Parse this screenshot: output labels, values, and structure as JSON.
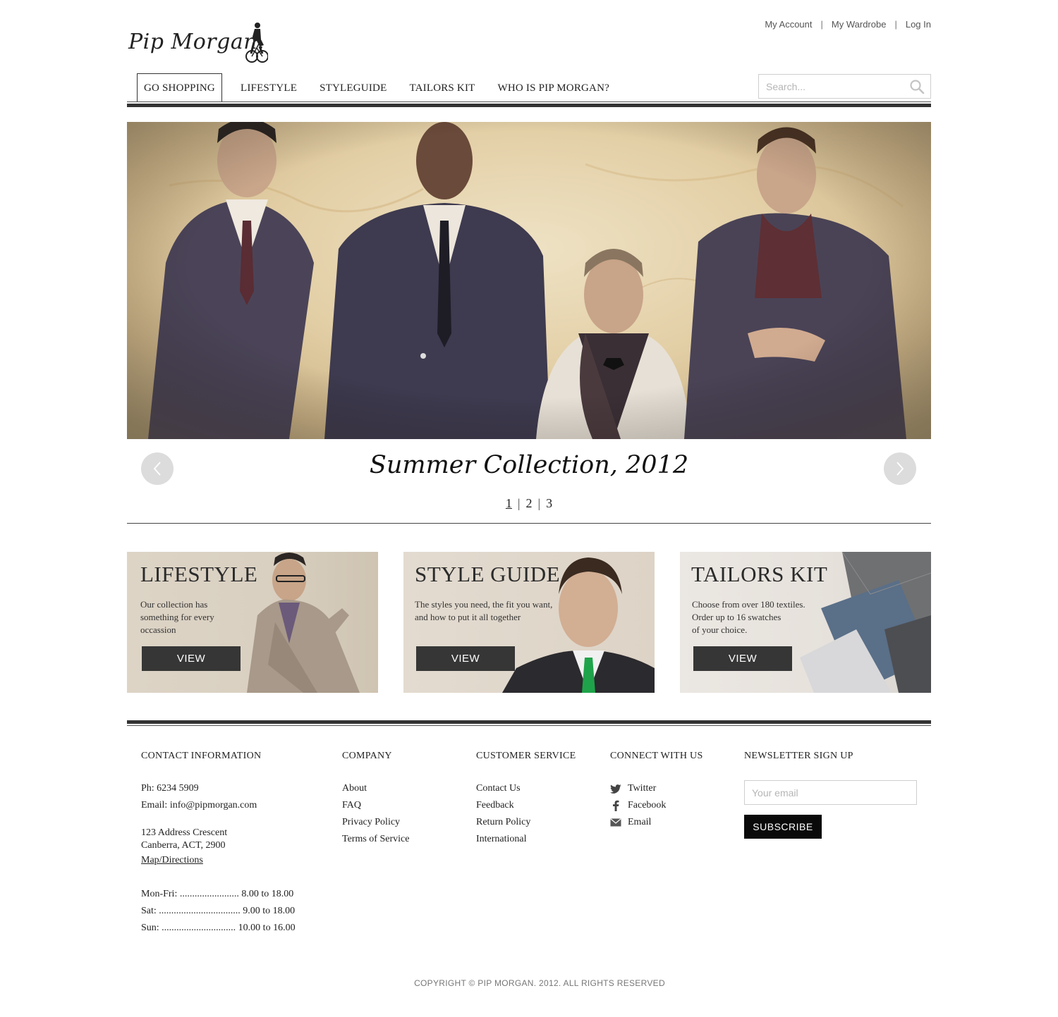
{
  "brand": {
    "logo_text": "Pip Morgan."
  },
  "top_links": [
    "My Account",
    "My Wardrobe",
    "Log In"
  ],
  "nav": {
    "items": [
      "GO SHOPPING",
      "LIFESTYLE",
      "STYLEGUIDE",
      "TAILORS KIT",
      "WHO IS PIP MORGAN?"
    ],
    "active": "GO SHOPPING"
  },
  "search": {
    "placeholder": "Search..."
  },
  "hero": {
    "caption": "Summer Collection, 2012",
    "pages": [
      "1",
      "2",
      "3"
    ],
    "current_page": "1"
  },
  "cards": [
    {
      "title": "LIFESTYLE",
      "description": "Our collection has\nsomething for every\noccassion",
      "button": "VIEW"
    },
    {
      "title": "STYLE GUIDE",
      "description": "The styles you need, the fit you want,\nand how to put it all together",
      "button": "VIEW"
    },
    {
      "title": "TAILORS KIT",
      "description": "Choose from over 180 textiles.\nOrder up to 16 swatches\nof your choice.",
      "button": "VIEW"
    }
  ],
  "footer": {
    "contact": {
      "heading": "CONTACT INFORMATION",
      "phone": "Ph: 6234 5909",
      "email": "Email: info@pipmorgan.com",
      "address_line1": "123 Address Crescent",
      "address_line2": "Canberra, ACT, 2900",
      "map_link": "Map/Directions",
      "hours": [
        "Mon-Fri: ........................ 8.00 to 18.00",
        "Sat: ................................. 9.00 to 18.00",
        "Sun: .............................. 10.00 to 16.00"
      ]
    },
    "company": {
      "heading": "COMPANY",
      "links": [
        "About",
        "FAQ",
        "Privacy Policy",
        "Terms of Service"
      ]
    },
    "customer_service": {
      "heading": "CUSTOMER SERVICE",
      "links": [
        "Contact Us",
        "Feedback",
        "Return Policy",
        "International"
      ]
    },
    "connect": {
      "heading": "CONNECT WITH US",
      "links": [
        {
          "label": "Twitter",
          "icon": "twitter-icon"
        },
        {
          "label": "Facebook",
          "icon": "facebook-icon"
        },
        {
          "label": "Email",
          "icon": "envelope-icon"
        }
      ]
    },
    "newsletter": {
      "heading": "NEWSLETTER SIGN UP",
      "placeholder": "Your email",
      "button": "SUBSCRIBE"
    },
    "copyright": "COPYRIGHT © PIP MORGAN. 2012. ALL RIGHTS RESERVED"
  },
  "colors": {
    "nav_rule": "#333333",
    "button_dark": "#363636",
    "subscribe_bg": "#0a0a0a",
    "hero_tone": "#e3cfa6"
  }
}
